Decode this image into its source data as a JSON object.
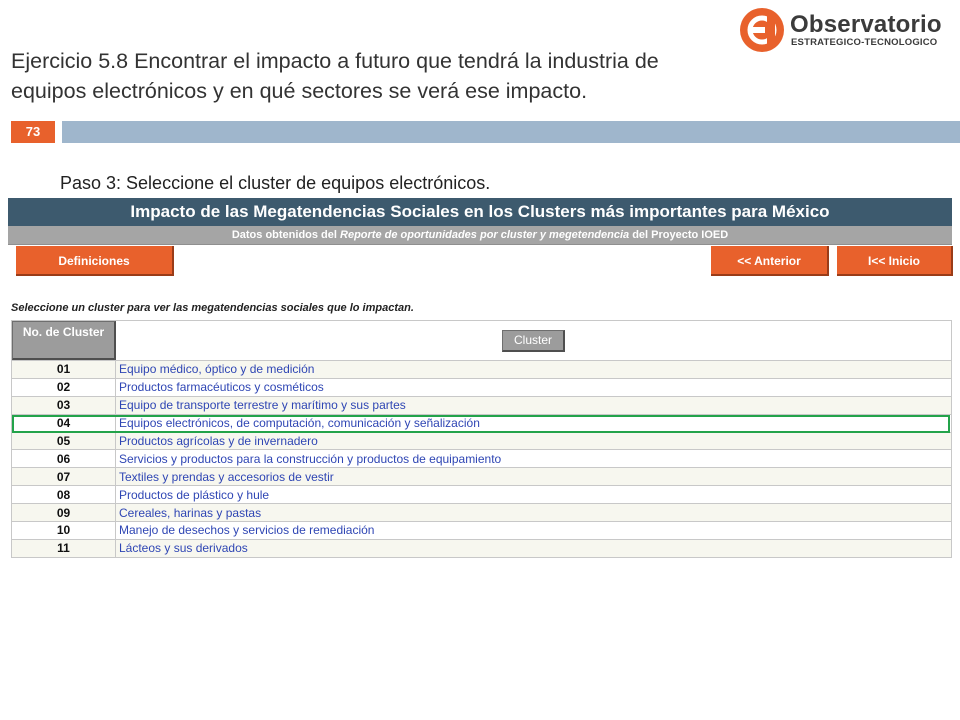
{
  "slide": {
    "title": "Ejercicio 5.8 Encontrar el impacto a futuro que tendrá la industria de equipos electrónicos y en qué sectores se verá ese impacto.",
    "number": "73",
    "step": "Paso 3: Seleccione el cluster de equipos electrónicos.",
    "accent_color": "#e8612c",
    "bar_color": "#9fb6cc"
  },
  "logo": {
    "name": "Observatorio",
    "subtitle": "ESTRATEGICO-TECNOLOGICO"
  },
  "app": {
    "header_title": "Impacto de las Megatendencias Sociales en los Clusters más importantes para México",
    "subheader": {
      "prefix": "Datos obtenidos del ",
      "italic": "Reporte de oportunidades por cluster y megetendencia",
      "suffix": " del Proyecto IOED"
    },
    "buttons": {
      "definitions": "Definiciones",
      "previous": "<< Anterior",
      "home": "I<< Inicio"
    },
    "instruction": "Seleccione un cluster para ver las megatendencias sociales que lo impactan.",
    "table": {
      "col_no_header": "No. de Cluster",
      "col_cluster_header": "Cluster",
      "selected_row": "04",
      "rows": [
        {
          "no": "01",
          "name": "Equipo médico, óptico y de medición"
        },
        {
          "no": "02",
          "name": "Productos farmacéuticos y cosméticos"
        },
        {
          "no": "03",
          "name": "Equipo de transporte terrestre y marítimo y sus partes"
        },
        {
          "no": "04",
          "name": "Equipos electrónicos, de computación, comunicación y señalización"
        },
        {
          "no": "05",
          "name": "Productos agrícolas y de invernadero"
        },
        {
          "no": "06",
          "name": "Servicios y productos para la construcción y productos de equipamiento"
        },
        {
          "no": "07",
          "name": "Textiles y prendas y accesorios de vestir"
        },
        {
          "no": "08",
          "name": "Productos de plástico y hule"
        },
        {
          "no": "09",
          "name": "Cereales, harinas y pastas"
        },
        {
          "no": "10",
          "name": "Manejo de desechos y servicios de remediación"
        },
        {
          "no": "11",
          "name": "Lácteos y sus derivados"
        }
      ]
    }
  }
}
